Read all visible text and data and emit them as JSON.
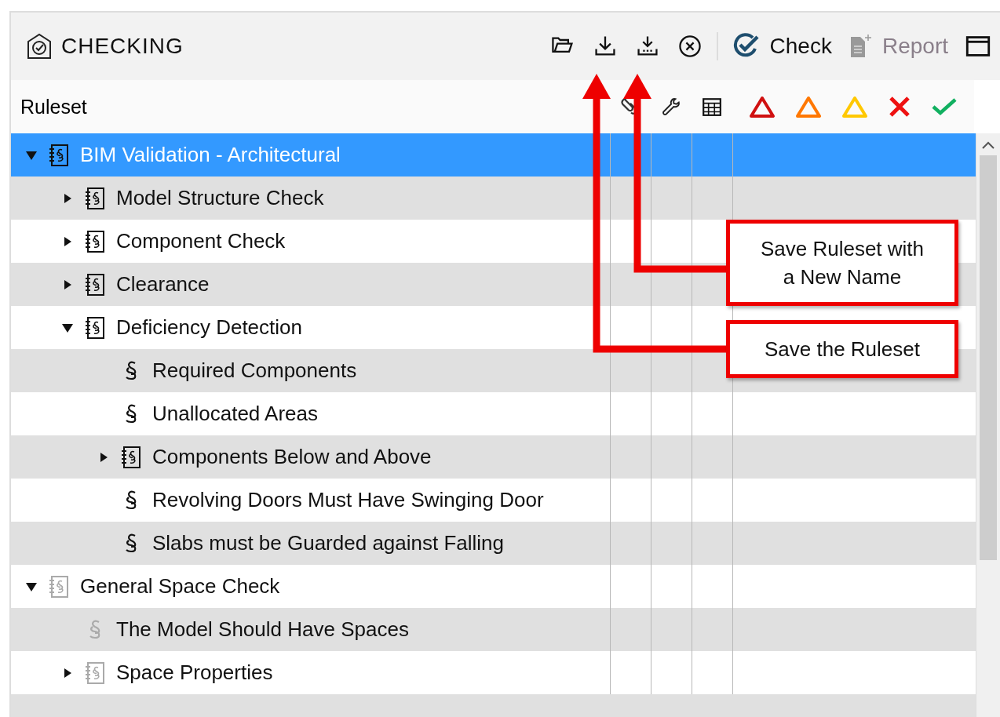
{
  "panel": {
    "title": "CHECKING"
  },
  "toolbar": [
    {
      "kind": "open"
    },
    {
      "kind": "save"
    },
    {
      "kind": "save-as"
    },
    {
      "kind": "close"
    },
    {
      "kind": "separator"
    },
    {
      "kind": "check",
      "label": "Check",
      "disabled": false
    },
    {
      "kind": "report",
      "label": "Report",
      "disabled": true
    },
    {
      "kind": "window"
    }
  ],
  "columns": {
    "title": "Ruleset",
    "icons": [
      {
        "kind": "link"
      },
      {
        "kind": "wrench"
      },
      {
        "kind": "table"
      }
    ],
    "severity": [
      {
        "kind": "critical"
      },
      {
        "kind": "major"
      },
      {
        "kind": "minor"
      },
      {
        "kind": "error"
      },
      {
        "kind": "ok"
      }
    ]
  },
  "tree": [
    {
      "label": "BIM Validation - Architectural",
      "selected": true,
      "expanded": true,
      "enabled": true,
      "kind": "ruleset",
      "children": [
        {
          "label": "Model Structure Check",
          "selected": false,
          "expanded": false,
          "enabled": true,
          "kind": "ruleset"
        },
        {
          "label": "Component Check",
          "selected": false,
          "expanded": false,
          "enabled": true,
          "kind": "ruleset"
        },
        {
          "label": "Clearance",
          "selected": false,
          "expanded": false,
          "enabled": true,
          "kind": "ruleset"
        },
        {
          "label": "Deficiency Detection",
          "selected": false,
          "expanded": true,
          "enabled": true,
          "kind": "ruleset",
          "children": [
            {
              "label": "Required Components",
              "selected": false,
              "enabled": true,
              "kind": "rule"
            },
            {
              "label": "Unallocated Areas",
              "selected": false,
              "enabled": true,
              "kind": "rule"
            },
            {
              "label": "Components Below and Above",
              "selected": false,
              "expanded": false,
              "enabled": true,
              "kind": "ruleset"
            },
            {
              "label": "Revolving Doors Must Have Swinging Door",
              "selected": false,
              "enabled": true,
              "kind": "rule"
            },
            {
              "label": "Slabs must be Guarded against Falling",
              "selected": false,
              "enabled": true,
              "kind": "rule"
            }
          ]
        }
      ]
    },
    {
      "label": "General Space Check",
      "selected": false,
      "expanded": true,
      "enabled": false,
      "kind": "ruleset",
      "children": [
        {
          "label": "The Model Should Have Spaces",
          "selected": false,
          "enabled": false,
          "kind": "rule"
        },
        {
          "label": "Space Properties",
          "selected": false,
          "expanded": false,
          "enabled": false,
          "kind": "ruleset"
        }
      ]
    }
  ],
  "callouts": [
    {
      "kind": "save-as",
      "text": "Save Ruleset with a New Name"
    },
    {
      "kind": "save",
      "text": "Save the Ruleset"
    }
  ]
}
